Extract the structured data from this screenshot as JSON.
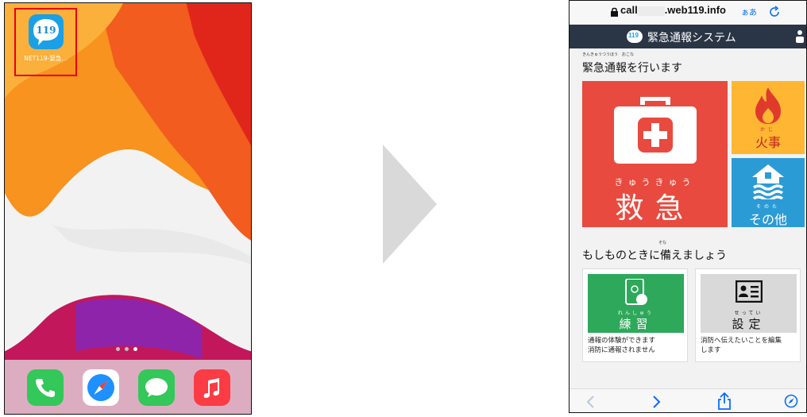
{
  "home_screen": {
    "app_label": "NET119-緊急…",
    "app_icon_text": "119"
  },
  "browser": {
    "url_prefix": "call",
    "url_suffix": ".web119.info",
    "text_size_label": "ぁあ"
  },
  "app": {
    "header_logo_text": "119",
    "header_title": "緊急通報システム",
    "section1_title": "緊急通報を行います",
    "section1_ruby": "きんきゅうつうほう　おこな",
    "emergency": {
      "ruby": "きゅうきゅう",
      "label": "救急"
    },
    "fire": {
      "ruby": "かじ",
      "label": "火事"
    },
    "other": {
      "ruby": "そのた",
      "label": "その他"
    },
    "section2_title": "もしものときに備えましょう",
    "section2_ruby": "そな",
    "practice": {
      "ruby": "れんしゅう",
      "label": "練習",
      "desc_line1": "通報の体験ができます",
      "desc_line2": "消防に通報されません"
    },
    "settings": {
      "ruby": "せってい",
      "label": "設定",
      "desc_line1": "消防へ伝えたいことを編集",
      "desc_line2": "します"
    }
  }
}
